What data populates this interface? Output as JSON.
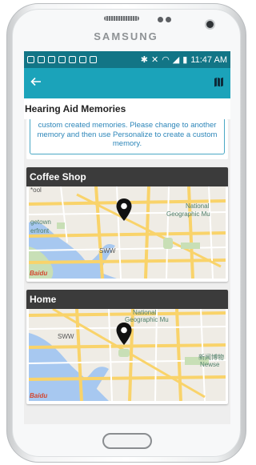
{
  "device": {
    "brand": "SAMSUNG"
  },
  "status_bar": {
    "time": "11:47 AM"
  },
  "app_bar": {
    "back_icon": "arrow-left-icon",
    "map_icon": "map-icon"
  },
  "page": {
    "title": "Hearing Aid Memories"
  },
  "info": {
    "text": "custom created memories. Please change to another memory and then use Personalize to create a custom memory."
  },
  "memories": [
    {
      "name": "Coffee Shop",
      "labels": {
        "top_left": "*ool",
        "national": "National",
        "geographic": "Geographic Mu",
        "sww": "SWW",
        "town": "getown",
        "front": "erfront"
      }
    },
    {
      "name": "Home",
      "labels": {
        "national": "National",
        "geographic": "Geographic Mu",
        "sww": "SWW",
        "cn": "新闻博物",
        "newse": "Newse"
      }
    }
  ],
  "map_logo": "Baidu",
  "colors": {
    "teal_dark": "#127586",
    "teal": "#1ba3ba",
    "header_dark": "#3b3b3b",
    "info_text": "#2d86b9"
  }
}
